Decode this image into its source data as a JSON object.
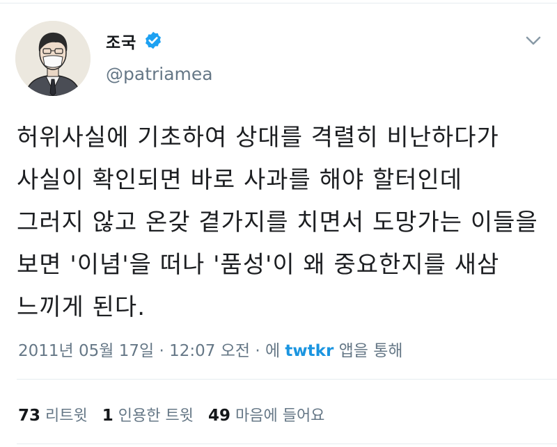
{
  "profile": {
    "display_name": "조국",
    "handle": "@patriamea",
    "verified_color": "#1da1f2"
  },
  "tweet": {
    "lines": [
      "허위사실에 기초하여 상대를 격렬히 비난하다가",
      "사실이 확인되면 바로 사과를 해야 할터인데",
      "그러지 않고 온갖 곁가지를 치면서 도망가는 이들을",
      "보면 '이념'을 떠나 '품성'이 왜 중요한지를 새삼",
      "느끼게 된다."
    ],
    "timestamp": "2011년 05월 17일 · 12:07 오전 · 에",
    "source": "twtkr",
    "source_suffix": "앱을 통해"
  },
  "stats": {
    "retweets_count": "73",
    "retweets_label": "리트윗",
    "quotes_count": "1",
    "quotes_label": "인용한 트윗",
    "likes_count": "49",
    "likes_label": "마음에 들어요"
  },
  "icons": {
    "verified": "verified-badge-icon",
    "caret": "chevron-down-icon"
  }
}
